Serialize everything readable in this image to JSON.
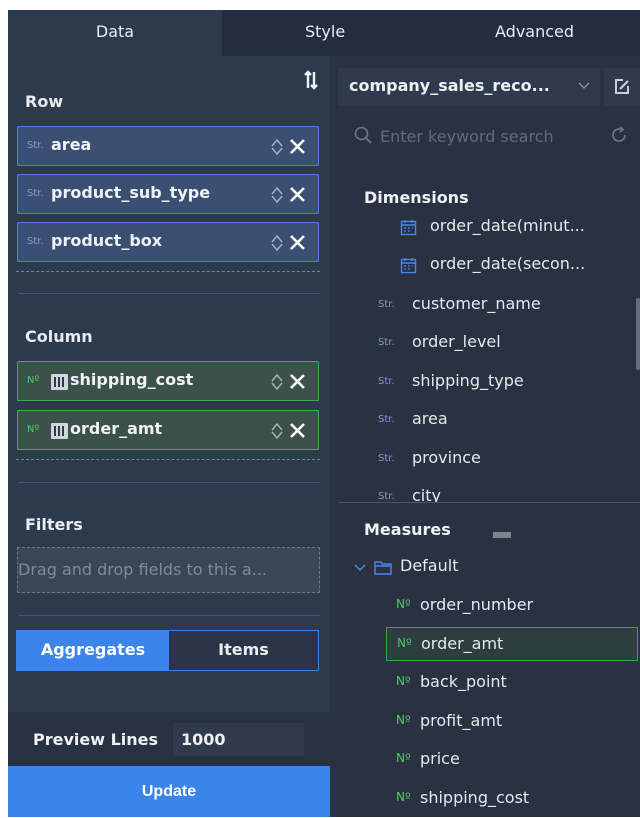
{
  "tabs": [
    "Data",
    "Style",
    "Advanced"
  ],
  "left": {
    "row": {
      "title": "Row",
      "fields": [
        {
          "tag": "Str.",
          "name": "area"
        },
        {
          "tag": "Str.",
          "name": "product_sub_type"
        },
        {
          "tag": "Str.",
          "name": "product_box"
        }
      ]
    },
    "column": {
      "title": "Column",
      "fields": [
        {
          "tag": "Nº",
          "name": "shipping_cost"
        },
        {
          "tag": "Nº",
          "name": "order_amt"
        }
      ]
    },
    "filters": {
      "title": "Filters",
      "placeholder": "Drag and drop fields to this a..."
    },
    "mode": {
      "aggregates": "Aggregates",
      "items": "Items"
    },
    "preview": {
      "label": "Preview Lines",
      "value": "1000"
    },
    "update_label": "Update"
  },
  "right": {
    "dataset": "company_sales_reco...",
    "search_placeholder": "Enter keyword search",
    "dimensions_title": "Dimensions",
    "dimensions": [
      {
        "type": "date",
        "name": "order_date(minut..."
      },
      {
        "type": "date",
        "name": "order_date(secon..."
      },
      {
        "type": "str",
        "tag": "Str.",
        "name": "customer_name"
      },
      {
        "type": "str",
        "tag": "Str.",
        "name": "order_level"
      },
      {
        "type": "str",
        "tag": "Str.",
        "name": "shipping_type"
      },
      {
        "type": "str",
        "tag": "Str.",
        "name": "area"
      },
      {
        "type": "str",
        "tag": "Str.",
        "name": "province"
      },
      {
        "type": "str",
        "tag": "Str.",
        "name": "city"
      }
    ],
    "measures_title": "Measures",
    "folder": "Default",
    "measures": [
      {
        "tag": "Nº",
        "name": "order_number"
      },
      {
        "tag": "Nº",
        "name": "order_amt"
      },
      {
        "tag": "Nº",
        "name": "back_point"
      },
      {
        "tag": "Nº",
        "name": "profit_amt"
      },
      {
        "tag": "Nº",
        "name": "price"
      },
      {
        "tag": "Nº",
        "name": "shipping_cost"
      }
    ]
  },
  "colors": {
    "accent": "#3b84ea",
    "string_field": "#4c7ce6",
    "number_field": "#3bb14b",
    "panel": "#2d3a4e"
  }
}
